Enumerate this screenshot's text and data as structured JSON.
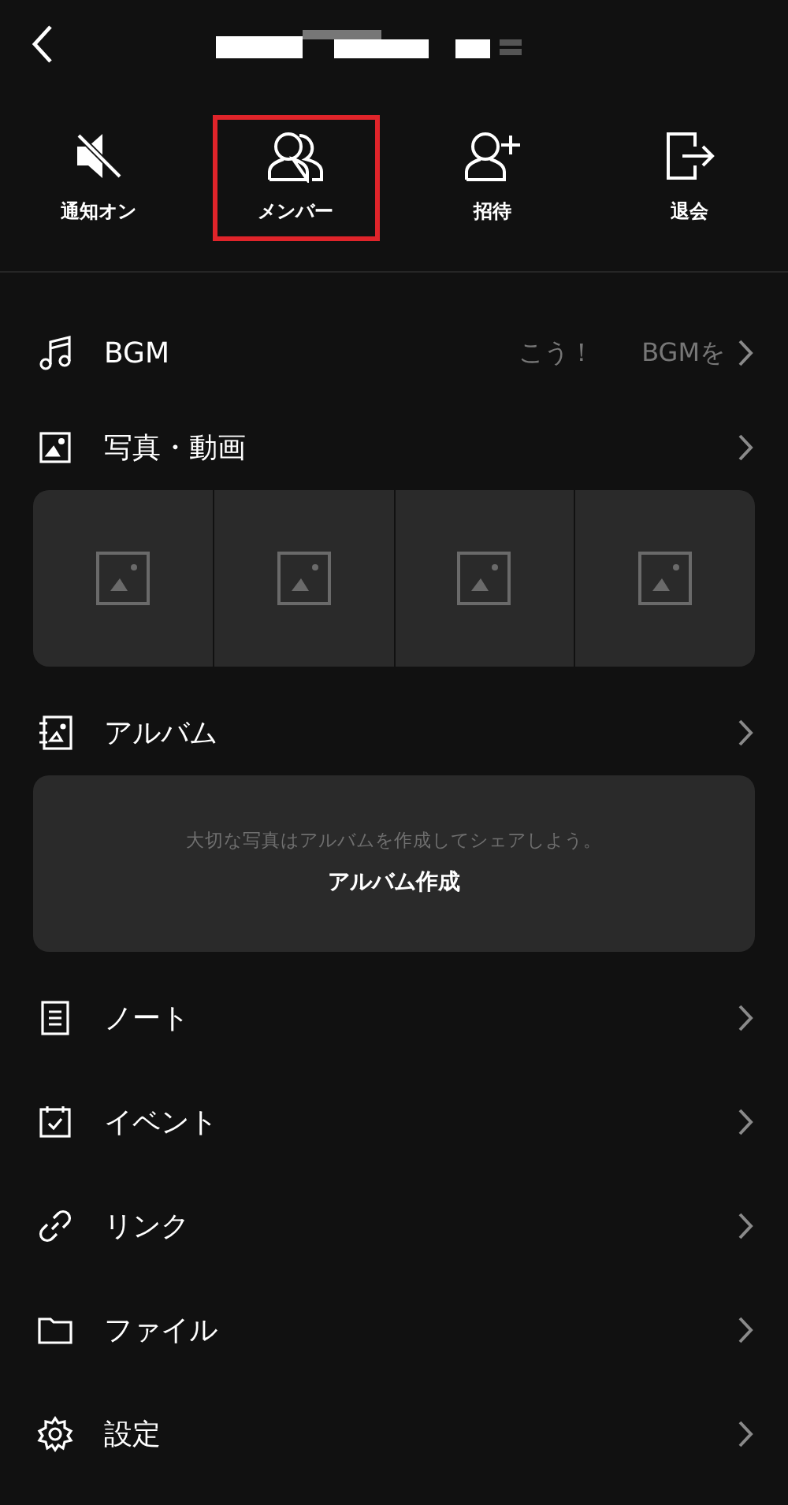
{
  "actions": [
    {
      "label": "通知オン",
      "highlighted": false
    },
    {
      "label": "メンバー",
      "highlighted": true
    },
    {
      "label": "招待",
      "highlighted": false
    },
    {
      "label": "退会",
      "highlighted": false
    }
  ],
  "sections": [
    {
      "kind": "bgm",
      "label": "BGM",
      "ticker": [
        "こう！",
        "BGMを"
      ]
    },
    {
      "kind": "photos",
      "label": "写真・動画",
      "thumbnails": [
        {
          "kind": "placeholder"
        },
        {
          "kind": "placeholder"
        },
        {
          "kind": "placeholder"
        },
        {
          "kind": "placeholder"
        }
      ]
    },
    {
      "kind": "album",
      "label": "アルバム",
      "hint": "大切な写真はアルバムを作成してシェアしよう。",
      "button": "アルバム作成"
    },
    {
      "kind": "plain",
      "label": "ノート"
    },
    {
      "kind": "plain",
      "label": "イベント"
    },
    {
      "kind": "plain",
      "label": "リンク"
    },
    {
      "kind": "plain",
      "label": "ファイル"
    },
    {
      "kind": "plain",
      "label": "設定"
    }
  ]
}
